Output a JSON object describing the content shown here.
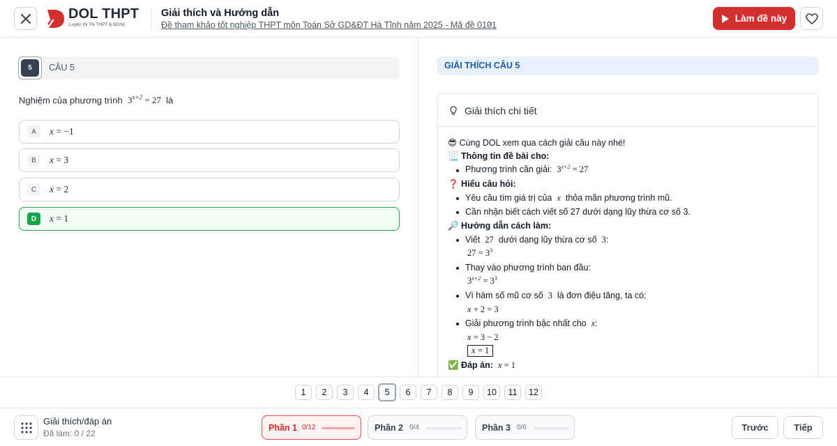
{
  "header": {
    "logo_text": "DOL THPT",
    "logo_sub": "Luyện thi TN THPT & ĐGNL",
    "title": "Giải thích và Hướng dẫn",
    "subtitle": "Đề tham khảo tốt nghiệp THPT môn Toán Sở GD&ĐT Hà Tĩnh năm 2025 - Mã đề 0101",
    "do_button": "Làm đề này",
    "accent_color": "#d32f2f"
  },
  "question": {
    "number": "5",
    "label": "CÂU 5",
    "text_before": "Nghiệm của phương trình",
    "text_after": "là",
    "options": [
      {
        "letter": "A",
        "value": "−1"
      },
      {
        "letter": "B",
        "value": "3"
      },
      {
        "letter": "C",
        "value": "2"
      },
      {
        "letter": "D",
        "value": "1",
        "correct": true
      }
    ]
  },
  "explanation": {
    "header": "GIẢI THÍCH CÂU 5",
    "card_title": "Giải thích chi tiết",
    "intro": "😎 Cùng DOL xem qua cách giải câu này nhé!",
    "info_heading": "📃 Thông tin đề bài cho:",
    "info_item": "Phương trình cần giải:",
    "understand_heading": "❓ Hiểu câu hỏi:",
    "understand_1a": "Yêu cầu tìm giá trị của",
    "understand_1b": "thỏa mãn phương trình mũ.",
    "understand_2": "Cần nhận biết cách viết số 27 dưới dạng lũy thừa cơ số 3.",
    "guide_heading": "🔎 Hướng dẫn cách làm:",
    "step1a": "Viết",
    "step1b": "dưới dạng lũy thừa cơ số",
    "step2": "Thay vào phương trình ban đầu:",
    "step3a": "Vì hàm số mũ cơ số",
    "step3b": "là đơn điệu tăng, ta có:",
    "step4": "Giải phương trình bậc nhất cho",
    "answer_label": "✅ Đáp án:"
  },
  "pager": {
    "pages": [
      "1",
      "2",
      "3",
      "4",
      "5",
      "6",
      "7",
      "8",
      "9",
      "10",
      "11",
      "12"
    ],
    "current": "5"
  },
  "footer": {
    "title": "Giải thích/đáp án",
    "progress": "Đã làm: 0 / 22",
    "parts": [
      {
        "name": "Phần 1",
        "count": "0/12",
        "active": true
      },
      {
        "name": "Phần 2",
        "count": "0/4"
      },
      {
        "name": "Phần 3",
        "count": "0/6"
      }
    ],
    "prev": "Trước",
    "next": "Tiếp"
  }
}
